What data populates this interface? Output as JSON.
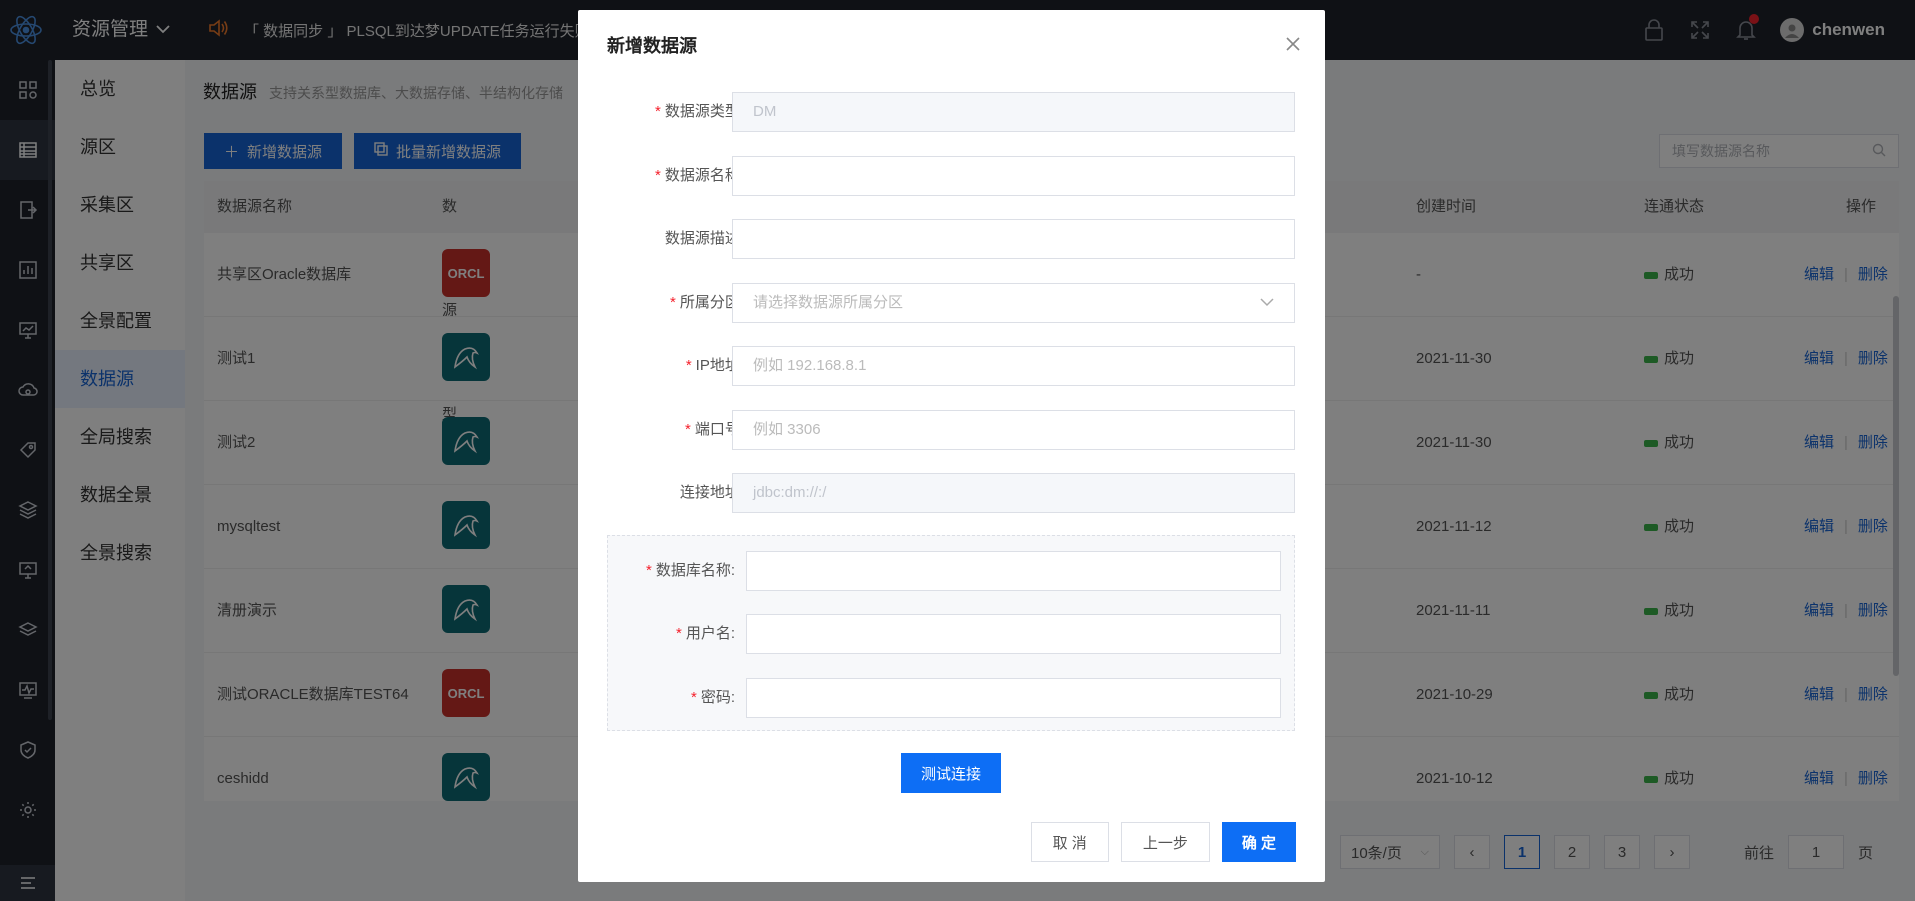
{
  "header": {
    "app_title": "资源管理",
    "notice": "「 数据同步 」 PLSQL到达梦UPDATE任务运行失败",
    "username": "chenwen",
    "icons": [
      "lock-icon",
      "fullscreen-icon",
      "bell-icon",
      "avatar"
    ]
  },
  "rail": {
    "items": [
      "dashboard-icon",
      "table-icon",
      "import-icon",
      "chart-icon",
      "monitor-icon",
      "cloud-icon",
      "tag-icon",
      "layers-icon",
      "screen-icon",
      "stack-icon",
      "pulse-icon",
      "shield-icon",
      "gear-icon"
    ],
    "bottom": "menu-icon"
  },
  "subnav": {
    "items": [
      "总览",
      "源区",
      "采集区",
      "共享区",
      "全景配置",
      "数据源",
      "全局搜索",
      "数据全景",
      "全景搜索"
    ],
    "active_index": 5
  },
  "main": {
    "title": "数据源",
    "desc": "支持关系型数据库、大数据存储、半结构化存储",
    "add_btn": "新增数据源",
    "batch_btn": "批量新增数据源",
    "search_placeholder": "填写数据源名称",
    "columns": {
      "name": "数据源名称",
      "type": "数据源类型",
      "created": "创建时间",
      "status": "连通状态",
      "ops": "操作"
    },
    "rows": [
      {
        "name": "共享区Oracle数据库",
        "type": "ORCL",
        "created": "-",
        "status": "成功"
      },
      {
        "name": "测试1",
        "type": "mysql",
        "created": "2021-11-30",
        "status": "成功"
      },
      {
        "name": "测试2",
        "type": "mysql",
        "created": "2021-11-30",
        "status": "成功"
      },
      {
        "name": "mysqltest",
        "type": "mysql",
        "created": "2021-11-12",
        "status": "成功"
      },
      {
        "name": "清册演示",
        "type": "mysql",
        "created": "2021-11-11",
        "status": "成功"
      },
      {
        "name": "测试ORACLE数据库TEST64",
        "type": "ORCL",
        "created": "2021-10-29",
        "status": "成功"
      },
      {
        "name": "ceshidd",
        "type": "mysql",
        "created": "2021-10-12",
        "status": "成功"
      }
    ],
    "edit_label": "编辑",
    "delete_label": "删除",
    "pager": {
      "page_size": "10条/页",
      "pages": [
        "1",
        "2",
        "3"
      ],
      "current": "1",
      "goto_prefix": "前往",
      "goto_value": "1",
      "goto_suffix": "页"
    },
    "colors": {
      "primary": "#1765d6",
      "success": "#3bb54a",
      "orcl": "#c8312b",
      "mysql": "#0c6a74"
    }
  },
  "modal": {
    "title": "新增数据源",
    "fields": {
      "type": {
        "label": "数据源类型:",
        "value": "DM",
        "required": true
      },
      "name": {
        "label": "数据源名称:",
        "value": "",
        "required": true
      },
      "desc": {
        "label": "数据源描述:",
        "value": "",
        "required": false
      },
      "partition": {
        "label": "所属分区:",
        "placeholder": "请选择数据源所属分区",
        "required": true
      },
      "ip": {
        "label": "IP地址:",
        "placeholder": "例如 192.168.8.1",
        "required": true
      },
      "port": {
        "label": "端口号:",
        "placeholder": "例如 3306",
        "required": true
      },
      "url": {
        "label": "连接地址:",
        "value": "jdbc:dm://:/",
        "required": false
      },
      "dbname": {
        "label": "数据库名称:",
        "value": "",
        "required": true
      },
      "username": {
        "label": "用户名:",
        "value": "",
        "required": true
      },
      "password": {
        "label": "密码:",
        "value": "",
        "required": true
      }
    },
    "test_btn": "测试连接",
    "cancel_btn": "取 消",
    "prev_btn": "上一步",
    "ok_btn": "确 定"
  }
}
